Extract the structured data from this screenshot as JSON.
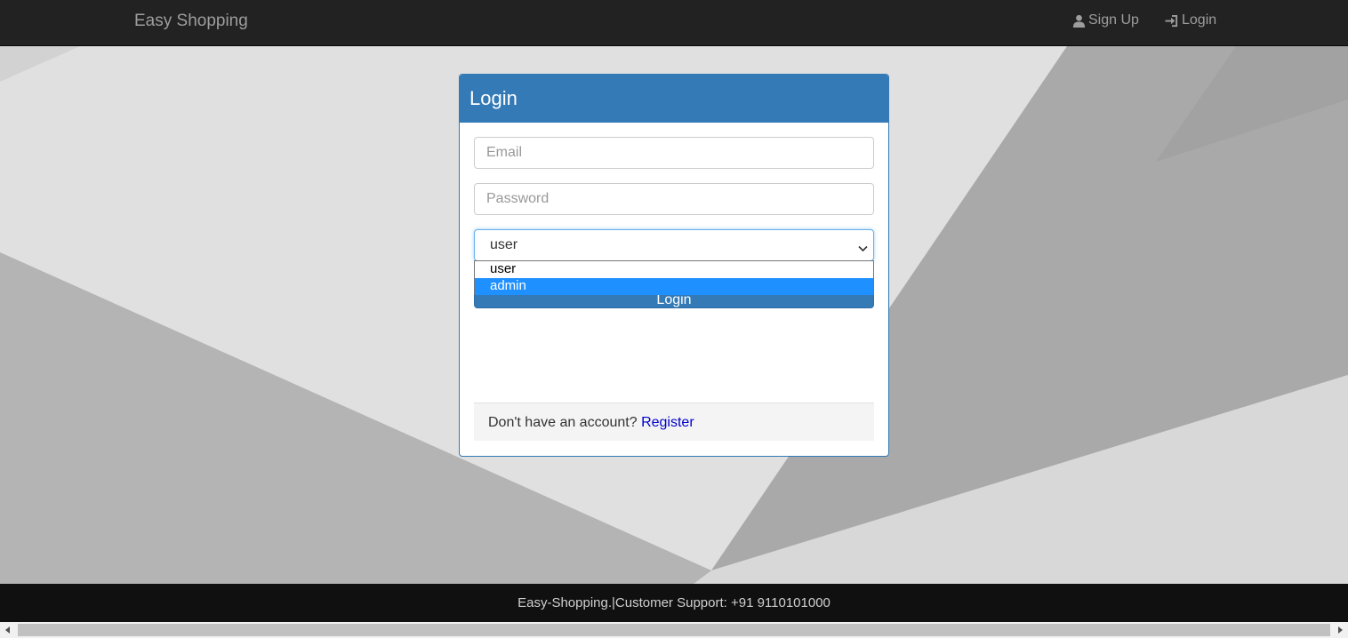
{
  "navbar": {
    "brand": "Easy Shopping",
    "signup_label": "Sign Up",
    "login_label": "Login"
  },
  "login_panel": {
    "title": "Login",
    "email_placeholder": "Email",
    "password_placeholder": "Password",
    "role_select": {
      "selected": "user",
      "options": [
        "user",
        "admin"
      ],
      "highlighted": "admin"
    },
    "submit_label": "Login",
    "footer_text": "Don't have an account?",
    "register_label": "Register"
  },
  "footer": {
    "text": "Easy-Shopping.|Customer Support: +91 9110101000"
  },
  "colors": {
    "navbar": "#222222",
    "panel_primary": "#337ab7",
    "highlight_option": "#1e90ff",
    "footer": "#101010",
    "link": "#0000cc"
  },
  "icons": {
    "signup": "user-icon",
    "login": "login-icon",
    "select": "chevron-down-icon"
  }
}
